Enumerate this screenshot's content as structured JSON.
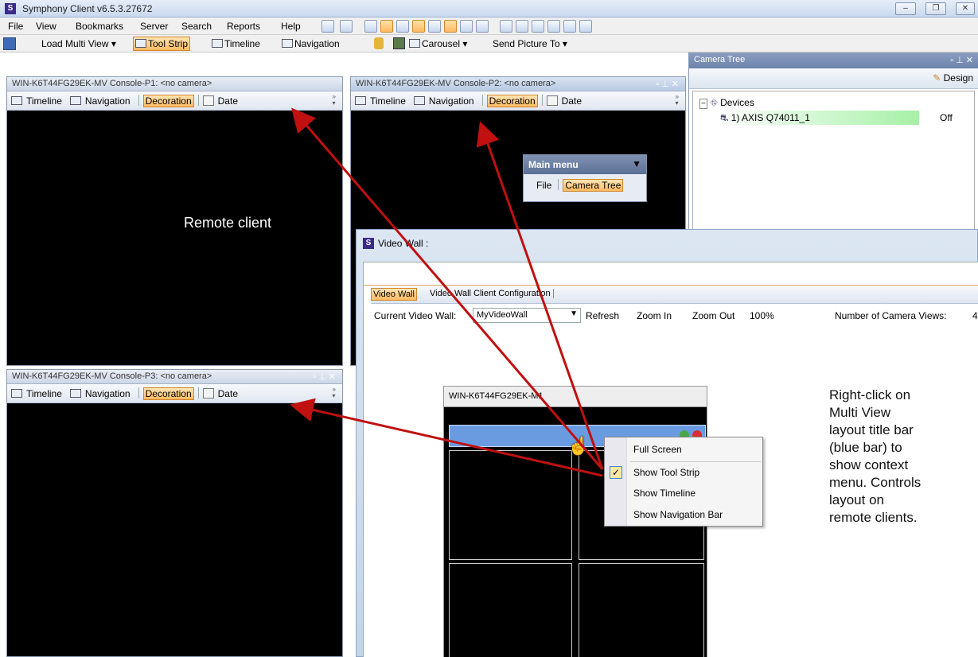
{
  "app": {
    "logo": "S",
    "title": "Symphony Client v6.5.3.27672",
    "window_buttons": [
      "–",
      "❐",
      "✕"
    ]
  },
  "menu": [
    "File",
    "View",
    "Bookmarks",
    "Server",
    "Search",
    "Reports",
    "Help"
  ],
  "toolbar": {
    "load_multi_view": "Load Multi View ▾",
    "tool_strip": "Tool Strip",
    "timeline": "Timeline",
    "navigation": "Navigation",
    "carousel": "Carousel ▾",
    "send_picture": "Send Picture To ▾"
  },
  "panes": [
    {
      "title": "WIN-K6T44FG29EK-MV Console-P1: <no camera>",
      "timeline": "Timeline",
      "navigation": "Navigation",
      "decoration": "Decoration",
      "date": "Date"
    },
    {
      "title": "WIN-K6T44FG29EK-MV Console-P2: <no camera>",
      "timeline": "Timeline",
      "navigation": "Navigation",
      "decoration": "Decoration",
      "date": "Date"
    },
    {
      "title": "WIN-K6T44FG29EK-MV Console-P3: <no camera>",
      "timeline": "Timeline",
      "navigation": "Navigation",
      "decoration": "Decoration",
      "date": "Date"
    }
  ],
  "remote_client_label": "Remote client",
  "main_menu": {
    "title": "Main menu",
    "file": "File",
    "camera_tree": "Camera Tree"
  },
  "camera_tree": {
    "title": "Camera Tree",
    "design": "Design",
    "devices": "Devices",
    "camera": "1) AXIS Q74011_1",
    "status": "Off",
    "status_color": "#a6f0a6"
  },
  "video_wall": {
    "window_title": "Video Wall :",
    "tabs": [
      "Video Wall",
      "Video Wall Client Configuration"
    ],
    "current_label": "Current Video Wall:",
    "current_value": "MyVideoWall",
    "refresh": "Refresh",
    "zoom_in": "Zoom In",
    "zoom_out": "Zoom Out",
    "zoom_level": "100%",
    "num_views_label": "Number of Camera Views:",
    "num_views_value": "4",
    "monitor_title": "WIN-K6T44FG29EK-M1"
  },
  "context_menu": [
    "Full Screen",
    "Show Tool Strip",
    "Show Timeline",
    "Show Navigation Bar"
  ],
  "annotation": [
    "Right-click on",
    "Multi View",
    "layout title bar",
    "(blue bar) to",
    "show context",
    "menu. Controls",
    "layout on",
    "remote clients."
  ],
  "colors": {
    "accent": "#ffb961",
    "arrow": "#c01010",
    "title_bar_blue": "#6a9be0"
  }
}
